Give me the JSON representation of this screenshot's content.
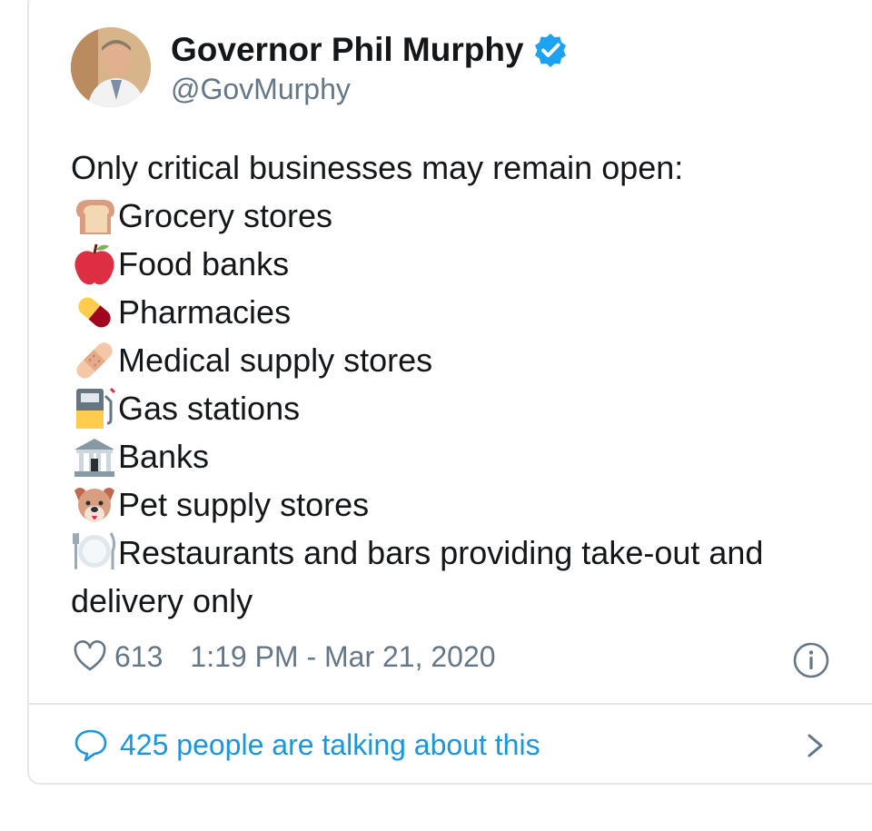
{
  "tweet": {
    "author_name": "Governor Phil Murphy",
    "handle": "@GovMurphy",
    "verified": true,
    "intro": "Only critical businesses may remain open:",
    "items": [
      {
        "icon": "bread-icon",
        "text": "Grocery stores"
      },
      {
        "icon": "apple-icon",
        "text": "Food banks"
      },
      {
        "icon": "pill-icon",
        "text": "Pharmacies"
      },
      {
        "icon": "bandage-icon",
        "text": "Medical supply stores"
      },
      {
        "icon": "fuel-pump-icon",
        "text": "Gas stations"
      },
      {
        "icon": "bank-icon",
        "text": "Banks"
      },
      {
        "icon": "dog-face-icon",
        "text": "Pet supply stores"
      },
      {
        "icon": "plate-cutlery-icon",
        "text": "Restaurants and bars providing take-out and delivery only"
      }
    ],
    "likes": "613",
    "timestamp": "1:19 PM - Mar 21, 2020",
    "conversation_text": "425 people are talking about this"
  },
  "colors": {
    "text": "#14171a",
    "secondary": "#657786",
    "link": "#1b95e0",
    "verified": "#1da1f2",
    "border": "#e1e8ed"
  }
}
